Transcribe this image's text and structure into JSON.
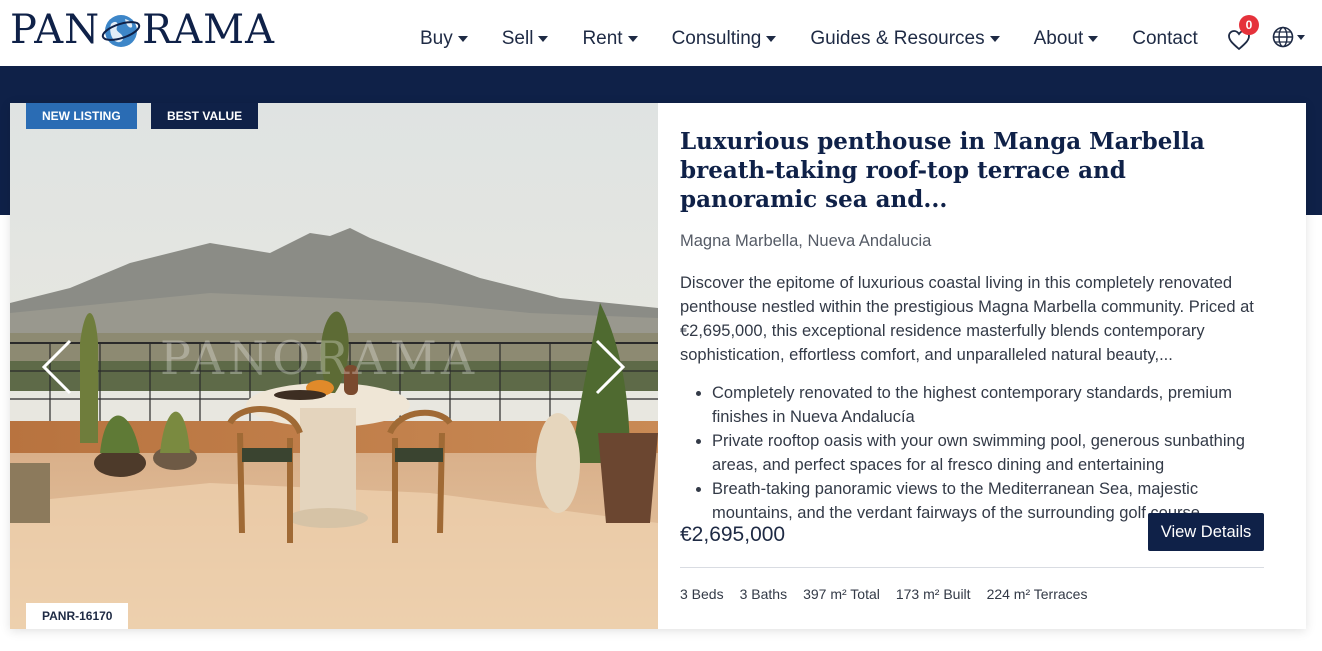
{
  "brand": {
    "logo_left": "PAN",
    "logo_right": "RAMA"
  },
  "nav": {
    "items": [
      {
        "label": "Buy",
        "dropdown": true
      },
      {
        "label": "Sell",
        "dropdown": true
      },
      {
        "label": "Rent",
        "dropdown": true
      },
      {
        "label": "Consulting",
        "dropdown": true
      },
      {
        "label": "Guides & Resources",
        "dropdown": true
      },
      {
        "label": "About",
        "dropdown": true
      },
      {
        "label": "Contact",
        "dropdown": false
      }
    ],
    "favorites_count": "0",
    "favorites_icon": "heart-icon",
    "language_icon": "globe-icon"
  },
  "colors": {
    "navy": "#0f2148",
    "accent_blue": "#2a6cb4",
    "badge_red": "#e5323b"
  },
  "listing": {
    "tags": [
      "NEW LISTING",
      "BEST VALUE"
    ],
    "reference": "PANR-16170",
    "watermark": "PANORAMA",
    "title": "Luxurious penthouse in Manga Marbella breath-taking roof-top terrace and panoramic sea and...",
    "location": "Magna Marbella, Nueva Andalucia",
    "description": "Discover the epitome of luxurious coastal living in this completely renovated penthouse nestled within the prestigious Magna Marbella community. Priced at €2,695,000, this exceptional residence masterfully blends contemporary sophistication, effortless comfort, and unparalleled natural beauty,...",
    "highlights": [
      "Completely renovated to the highest contemporary standards, premium finishes in Nueva Andalucía",
      "Private rooftop oasis with your own swimming pool, generous sunbathing areas, and perfect spaces for al fresco dining and entertaining",
      "Breath-taking panoramic views to the Mediterranean Sea, majestic mountains, and the verdant fairways of the surrounding golf course"
    ],
    "price": "€2,695,000",
    "cta": "View Details",
    "specs": [
      "3 Beds",
      "3 Baths",
      "397 m² Total",
      "173 m² Built",
      "224 m² Terraces"
    ]
  }
}
